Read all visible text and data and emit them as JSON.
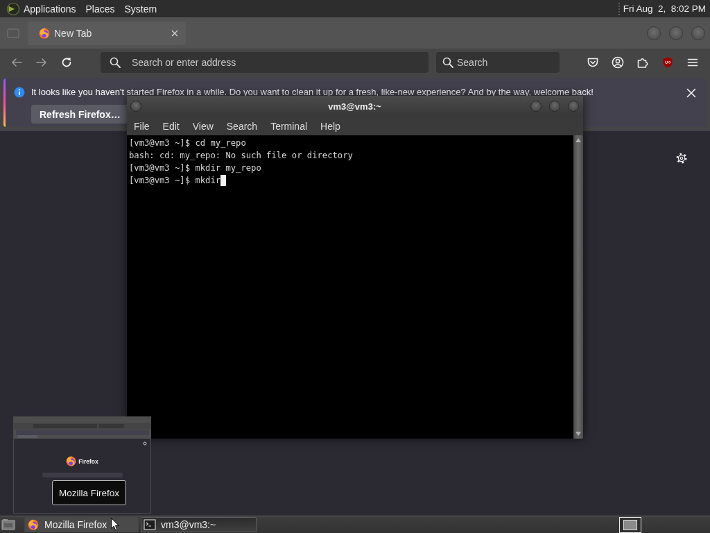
{
  "top_panel": {
    "menus": [
      "Applications",
      "Places",
      "System"
    ],
    "clock": "Fri Aug  2,  8:02 PM"
  },
  "browser": {
    "tabs": [
      {
        "label": "New Tab",
        "selected": true
      }
    ],
    "back": {
      "disabled": true
    },
    "forward": {
      "disabled": true
    },
    "address_bar": {
      "placeholder": "Search or enter address"
    },
    "search_bar": {
      "placeholder": "Search"
    },
    "notification": {
      "message": "It looks like you haven't started Firefox in a while. Do you want to clean it up for a fresh, like-new experience? And by the way, welcome back!",
      "button": "Refresh Firefox…"
    }
  },
  "terminal": {
    "title": "vm3@vm3:~",
    "menus": [
      "File",
      "Edit",
      "View",
      "Search",
      "Terminal",
      "Help"
    ],
    "lines": [
      "[vm3@vm3 ~]$ cd my_repo",
      "bash: cd: my_repo: No such file or directory",
      "[vm3@vm3 ~]$ mkdir my_repo",
      "[vm3@vm3 ~]$ mkdir"
    ]
  },
  "window_preview": {
    "logo_text": "Firefox",
    "tooltip": "Mozilla Firefox"
  },
  "taskbar": {
    "tasks": [
      {
        "kind": "browser",
        "label": "Mozilla Firefox",
        "selected": false
      },
      {
        "kind": "terminal",
        "label": "vm3@vm3:~",
        "selected": true
      }
    ]
  }
}
